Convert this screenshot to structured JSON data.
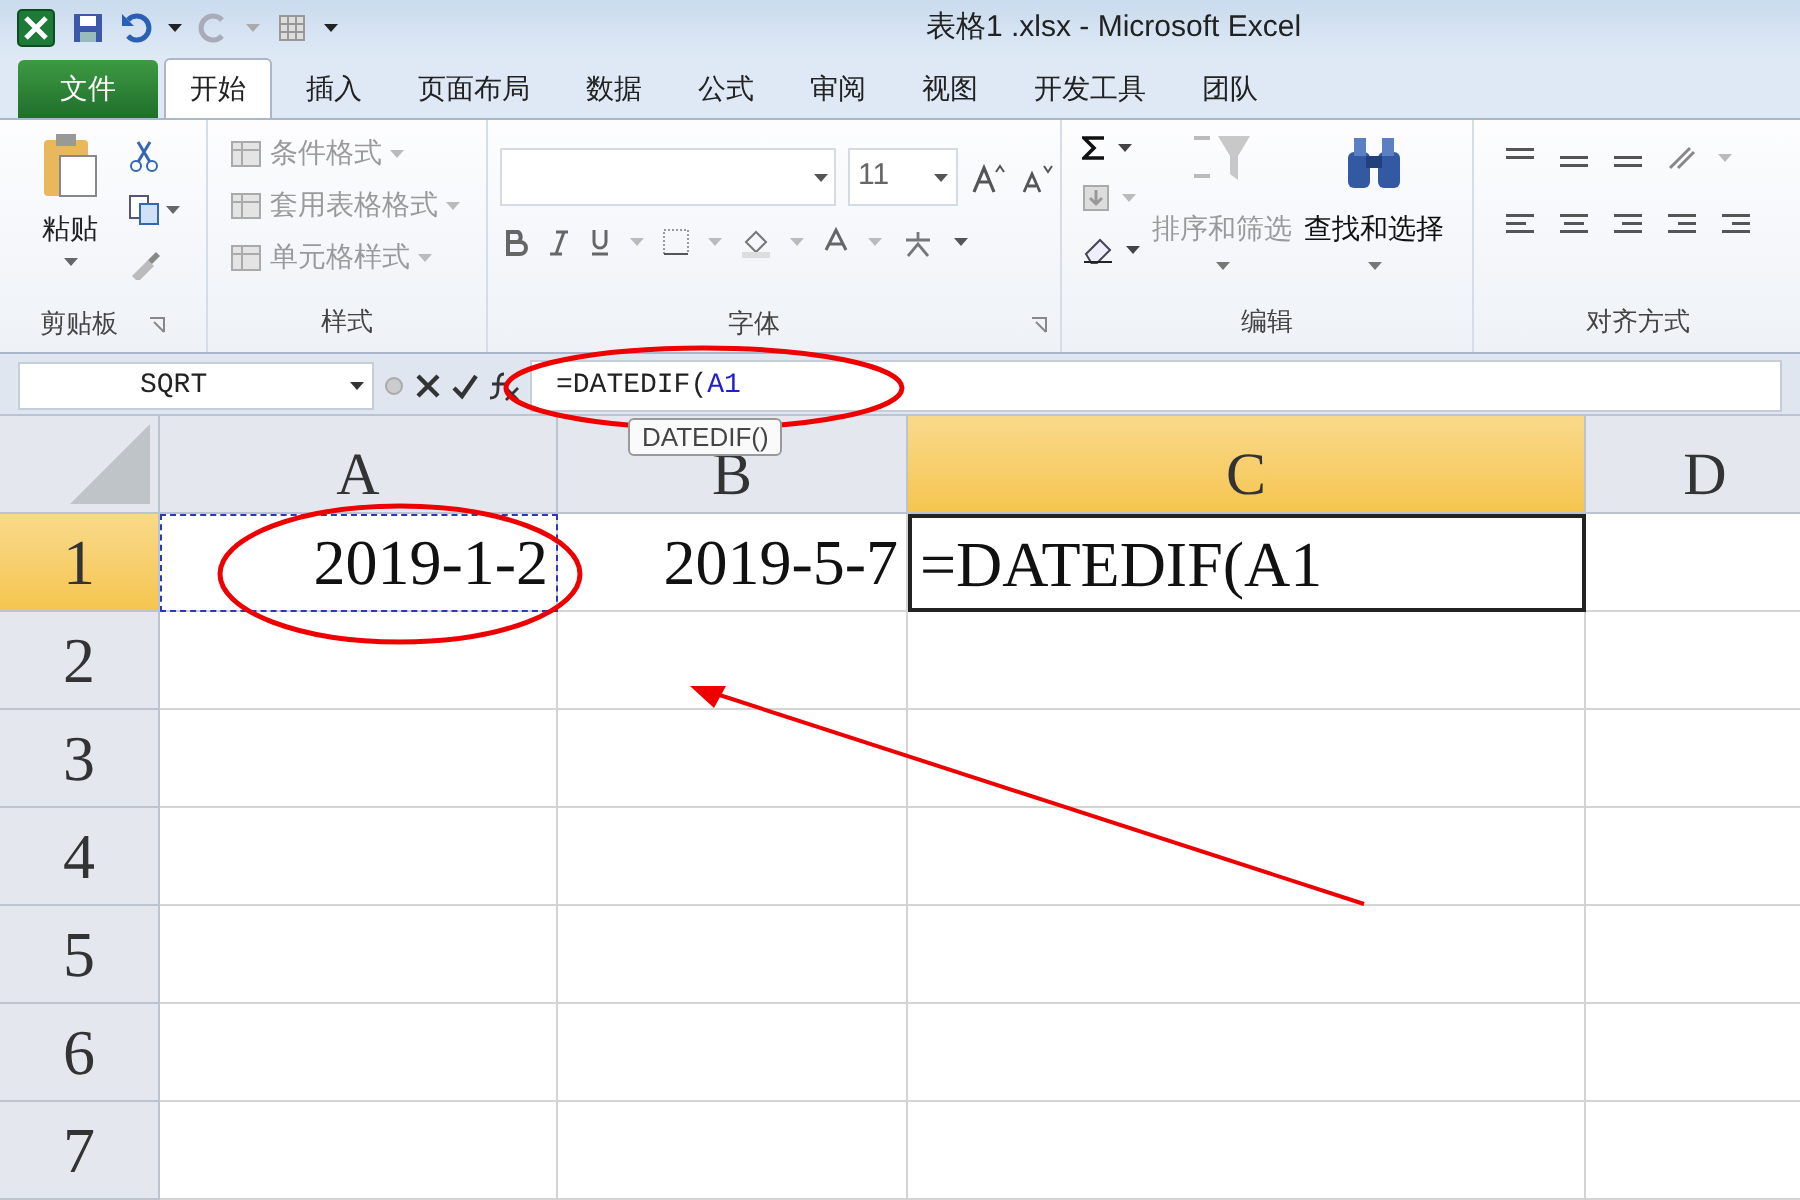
{
  "window": {
    "title": "表格1 .xlsx - Microsoft Excel"
  },
  "file_tab": "文件",
  "tabs": [
    {
      "label": "开始",
      "selected": true
    },
    {
      "label": "插入",
      "selected": false
    },
    {
      "label": "页面布局",
      "selected": false
    },
    {
      "label": "数据",
      "selected": false
    },
    {
      "label": "公式",
      "selected": false
    },
    {
      "label": "审阅",
      "selected": false
    },
    {
      "label": "视图",
      "selected": false
    },
    {
      "label": "开发工具",
      "selected": false
    },
    {
      "label": "团队",
      "selected": false
    }
  ],
  "clipboard": {
    "paste": "粘贴",
    "label": "剪贴板"
  },
  "styles": {
    "label": "样式",
    "items": [
      {
        "label": "条件格式",
        "disabled": true
      },
      {
        "label": "套用表格格式",
        "disabled": true
      },
      {
        "label": "单元格样式",
        "disabled": true
      }
    ]
  },
  "font": {
    "size": "11",
    "label": "字体"
  },
  "editing": {
    "label": "编辑",
    "buttons": [
      {
        "label": "排序和筛选",
        "disabled": true
      },
      {
        "label": "查找和选择",
        "disabled": false
      }
    ]
  },
  "alignment": {
    "label": "对齐方式"
  },
  "name_box": "SQRT",
  "formula": {
    "text": "=DATEDIF(",
    "ref": "A1"
  },
  "tooltip": "DATEDIF()",
  "columns": [
    {
      "label": "A",
      "selected": false
    },
    {
      "label": "B",
      "selected": false
    },
    {
      "label": "C",
      "selected": true
    },
    {
      "label": "D",
      "selected": false
    }
  ],
  "rows": [
    {
      "label": "1",
      "selected": true,
      "cells": [
        {
          "text": "2019-1-2",
          "active": false,
          "copy_marked": true
        },
        {
          "text": "2019-5-7",
          "active": false,
          "copy_marked": false
        },
        {
          "text": "=DATEDIF(A1",
          "active": true,
          "copy_marked": false
        }
      ]
    },
    {
      "label": "2",
      "selected": false
    },
    {
      "label": "3",
      "selected": false
    },
    {
      "label": "4",
      "selected": false
    },
    {
      "label": "5",
      "selected": false
    },
    {
      "label": "6",
      "selected": false
    },
    {
      "label": "7",
      "selected": false
    }
  ]
}
